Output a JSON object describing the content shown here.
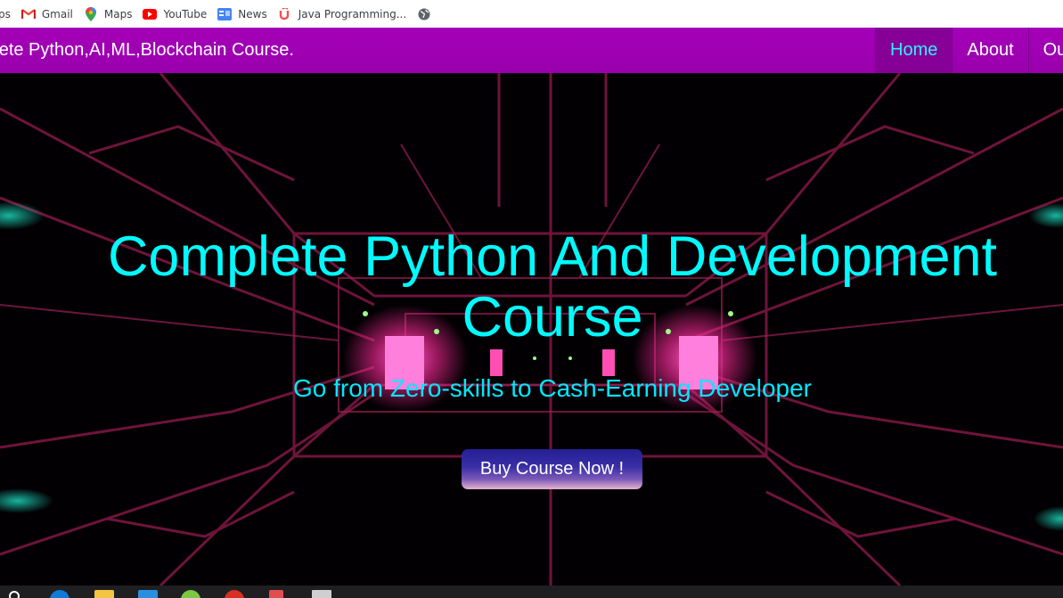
{
  "bookmarks": {
    "items": [
      {
        "label": "ps",
        "icon": "apps-icon"
      },
      {
        "label": "Gmail",
        "icon": "gmail-icon"
      },
      {
        "label": "Maps",
        "icon": "maps-icon"
      },
      {
        "label": "YouTube",
        "icon": "youtube-icon"
      },
      {
        "label": "News",
        "icon": "news-icon"
      },
      {
        "label": "Java Programming...",
        "icon": "udemy-icon"
      }
    ],
    "extra_icon": "globe-icon"
  },
  "navbar": {
    "brand": "nplete Python,AI,ML,Blockchain Course.",
    "links": [
      {
        "label": "Home",
        "active": true
      },
      {
        "label": "About",
        "active": false
      },
      {
        "label": "Ou",
        "active": false
      }
    ]
  },
  "hero": {
    "title": "Complete Python And Development Course",
    "subtitle": "Go from Zero-skills to Cash-Earning Developer",
    "cta_label": "Buy Course Now !"
  },
  "colors": {
    "nav_bg": "#a400b8",
    "accent_cyan": "#00fbff",
    "hero_bg": "#000000",
    "neon_pink": "#ff3fb0"
  }
}
